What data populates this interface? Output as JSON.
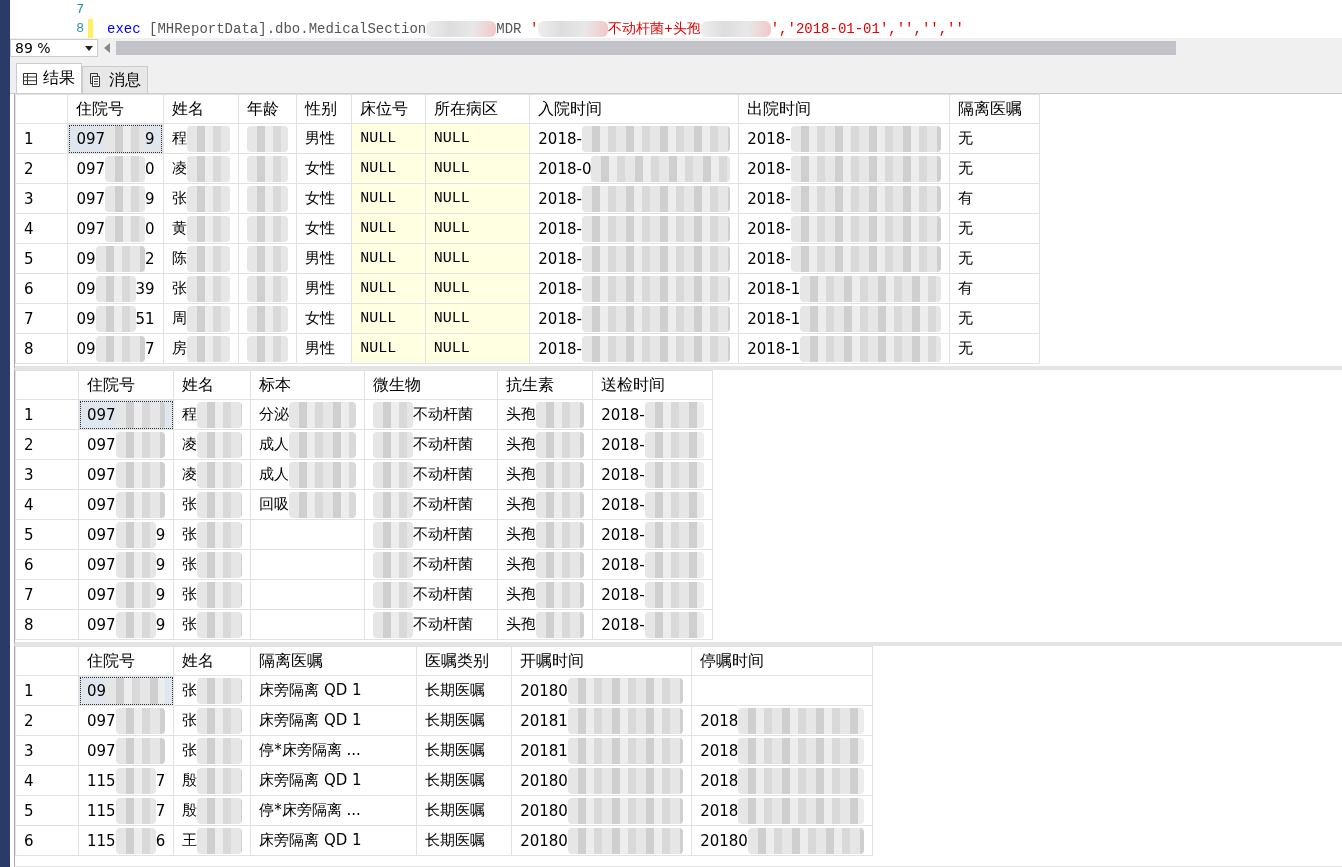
{
  "editor": {
    "lines": [
      {
        "number": "7",
        "changed": false
      },
      {
        "number": "8",
        "changed": true,
        "segments": [
          {
            "kind": "keyword",
            "text": "exec"
          },
          {
            "kind": "plain",
            "text": " [MHReportData].dbo.MedicalSection"
          },
          {
            "kind": "redacted"
          },
          {
            "kind": "plain",
            "text": "MDR "
          },
          {
            "kind": "string",
            "text": "'"
          },
          {
            "kind": "redacted"
          },
          {
            "kind": "string",
            "text": "不动杆菌+头孢"
          },
          {
            "kind": "redacted"
          },
          {
            "kind": "string",
            "text": "','2018-01-01','','',''"
          }
        ]
      }
    ]
  },
  "zoom": "89 %",
  "tabs": [
    {
      "label": "结果",
      "selected": true
    },
    {
      "label": "消息",
      "selected": false
    }
  ],
  "results": [
    {
      "columns": [
        "住院号",
        "姓名",
        "年龄",
        "性别",
        "床位号",
        "所在病区",
        "入院时间",
        "出院时间",
        "隔离医嘱"
      ],
      "rows": [
        {
          "num": "1",
          "focused": true,
          "cells": [
            {
              "text": "097",
              "tail": "9",
              "redacted": true
            },
            {
              "text": "程",
              "redacted": true
            },
            {
              "redacted": true
            },
            {
              "text": "男性"
            },
            {
              "text": "NULL",
              "kind": "null"
            },
            {
              "text": "NULL",
              "kind": "null"
            },
            {
              "text": "2018-",
              "redacted": true
            },
            {
              "text": "2018-",
              "redacted": true
            },
            {
              "text": "无"
            }
          ]
        },
        {
          "num": "2",
          "focused": false,
          "cells": [
            {
              "text": "097",
              "tail": "0",
              "redacted": true
            },
            {
              "text": "凌",
              "redacted": true
            },
            {
              "redacted": true
            },
            {
              "text": "女性"
            },
            {
              "text": "NULL",
              "kind": "null"
            },
            {
              "text": "NULL",
              "kind": "null"
            },
            {
              "text": "2018-0",
              "redacted": true
            },
            {
              "text": "2018-",
              "redacted": true
            },
            {
              "text": "无"
            }
          ]
        },
        {
          "num": "3",
          "focused": false,
          "cells": [
            {
              "text": "097",
              "tail": "9",
              "redacted": true
            },
            {
              "text": "张",
              "redacted": true
            },
            {
              "redacted": true
            },
            {
              "text": "女性"
            },
            {
              "text": "NULL",
              "kind": "null"
            },
            {
              "text": "NULL",
              "kind": "null"
            },
            {
              "text": "2018-",
              "redacted": true
            },
            {
              "text": "2018-",
              "redacted": true
            },
            {
              "text": "有"
            }
          ]
        },
        {
          "num": "4",
          "focused": false,
          "cells": [
            {
              "text": "097",
              "tail": "0",
              "redacted": true
            },
            {
              "text": "黄",
              "redacted": true
            },
            {
              "redacted": true
            },
            {
              "text": "女性"
            },
            {
              "text": "NULL",
              "kind": "null"
            },
            {
              "text": "NULL",
              "kind": "null"
            },
            {
              "text": "2018-",
              "redacted": true
            },
            {
              "text": "2018-",
              "redacted": true
            },
            {
              "text": "无"
            }
          ]
        },
        {
          "num": "5",
          "focused": false,
          "cells": [
            {
              "text": "09",
              "tail": "2",
              "redacted": true
            },
            {
              "text": "陈",
              "redacted": true
            },
            {
              "redacted": true
            },
            {
              "text": "男性"
            },
            {
              "text": "NULL",
              "kind": "null"
            },
            {
              "text": "NULL",
              "kind": "null"
            },
            {
              "text": "2018-",
              "redacted": true
            },
            {
              "text": "2018-",
              "redacted": true
            },
            {
              "text": "无"
            }
          ]
        },
        {
          "num": "6",
          "focused": false,
          "cells": [
            {
              "text": "09",
              "tail": "39",
              "redacted": true
            },
            {
              "text": "张",
              "redacted": true
            },
            {
              "redacted": true
            },
            {
              "text": "男性"
            },
            {
              "text": "NULL",
              "kind": "null"
            },
            {
              "text": "NULL",
              "kind": "null"
            },
            {
              "text": "2018-",
              "redacted": true
            },
            {
              "text": "2018-1",
              "redacted": true
            },
            {
              "text": "有"
            }
          ]
        },
        {
          "num": "7",
          "focused": false,
          "cells": [
            {
              "text": "09",
              "tail": "51",
              "redacted": true
            },
            {
              "text": "周",
              "redacted": true
            },
            {
              "redacted": true
            },
            {
              "text": "女性"
            },
            {
              "text": "NULL",
              "kind": "null"
            },
            {
              "text": "NULL",
              "kind": "null"
            },
            {
              "text": "2018-",
              "redacted": true
            },
            {
              "text": "2018-1",
              "redacted": true
            },
            {
              "text": "无"
            }
          ]
        },
        {
          "num": "8",
          "focused": false,
          "cells": [
            {
              "text": "09",
              "tail": "7",
              "redacted": true
            },
            {
              "text": "房",
              "redacted": true
            },
            {
              "redacted": true
            },
            {
              "text": "男性"
            },
            {
              "text": "NULL",
              "kind": "null"
            },
            {
              "text": "NULL",
              "kind": "null"
            },
            {
              "text": "2018-",
              "redacted": true
            },
            {
              "text": "2018-1",
              "redacted": true
            },
            {
              "text": "无"
            }
          ]
        }
      ]
    },
    {
      "columns": [
        "住院号",
        "姓名",
        "标本",
        "微生物",
        "抗生素",
        "送检时间"
      ],
      "rows": [
        {
          "num": "1",
          "focused": true,
          "cells": [
            {
              "text": "097",
              "redacted": true
            },
            {
              "text": "程",
              "redacted": true
            },
            {
              "text": "分泌",
              "redacted": true
            },
            {
              "text": "不动杆菌",
              "redacted": true,
              "lead": true
            },
            {
              "text": "头孢",
              "redacted": true
            },
            {
              "text": "2018-",
              "redacted": true
            }
          ]
        },
        {
          "num": "2",
          "focused": false,
          "cells": [
            {
              "text": "097",
              "redacted": true
            },
            {
              "text": "凌",
              "redacted": true
            },
            {
              "text": "成人",
              "redacted": true
            },
            {
              "text": "不动杆菌",
              "redacted": true,
              "lead": true
            },
            {
              "text": "头孢",
              "redacted": true
            },
            {
              "text": "2018-",
              "redacted": true
            }
          ]
        },
        {
          "num": "3",
          "focused": false,
          "cells": [
            {
              "text": "097",
              "redacted": true
            },
            {
              "text": "凌",
              "redacted": true
            },
            {
              "text": "成人",
              "redacted": true
            },
            {
              "text": "不动杆菌",
              "redacted": true,
              "lead": true
            },
            {
              "text": "头孢",
              "redacted": true
            },
            {
              "text": "2018-",
              "redacted": true
            }
          ]
        },
        {
          "num": "4",
          "focused": false,
          "cells": [
            {
              "text": "097",
              "redacted": true
            },
            {
              "text": "张",
              "redacted": true
            },
            {
              "text": "回吸",
              "redacted": true
            },
            {
              "text": "不动杆菌",
              "redacted": true,
              "lead": true
            },
            {
              "text": "头孢",
              "redacted": true
            },
            {
              "text": "2018-",
              "redacted": true
            }
          ]
        },
        {
          "num": "5",
          "focused": false,
          "cells": [
            {
              "text": "097",
              "tail": "9",
              "redacted": true
            },
            {
              "text": "张",
              "redacted": true
            },
            {},
            {
              "text": "不动杆菌",
              "redacted": true,
              "lead": true
            },
            {
              "text": "头孢",
              "redacted": true
            },
            {
              "text": "2018-",
              "redacted": true
            }
          ]
        },
        {
          "num": "6",
          "focused": false,
          "cells": [
            {
              "text": "097",
              "tail": "9",
              "redacted": true
            },
            {
              "text": "张",
              "redacted": true
            },
            {},
            {
              "text": "不动杆菌",
              "redacted": true,
              "lead": true
            },
            {
              "text": "头孢",
              "redacted": true
            },
            {
              "text": "2018-",
              "redacted": true
            }
          ]
        },
        {
          "num": "7",
          "focused": false,
          "cells": [
            {
              "text": "097",
              "tail": "9",
              "redacted": true
            },
            {
              "text": "张",
              "redacted": true
            },
            {},
            {
              "text": "不动杆菌",
              "redacted": true,
              "lead": true
            },
            {
              "text": "头孢",
              "redacted": true
            },
            {
              "text": "2018-",
              "redacted": true
            }
          ]
        },
        {
          "num": "8",
          "focused": false,
          "cells": [
            {
              "text": "097",
              "tail": "9",
              "redacted": true
            },
            {
              "text": "张",
              "redacted": true
            },
            {},
            {
              "text": "不动杆菌",
              "redacted": true,
              "lead": true
            },
            {
              "text": "头孢",
              "redacted": true
            },
            {
              "text": "2018-",
              "redacted": true
            }
          ]
        }
      ]
    },
    {
      "columns": [
        "住院号",
        "姓名",
        "隔离医嘱",
        "医嘱类别",
        "开嘱时间",
        "停嘱时间"
      ],
      "rows": [
        {
          "num": "1",
          "focused": true,
          "cells": [
            {
              "text": "09",
              "redacted": true
            },
            {
              "text": "张",
              "redacted": true
            },
            {
              "text": "床旁隔离    QD 1"
            },
            {
              "text": "长期医嘱"
            },
            {
              "text": "20180",
              "redacted": true
            },
            {}
          ]
        },
        {
          "num": "2",
          "focused": false,
          "cells": [
            {
              "text": "097",
              "redacted": true
            },
            {
              "text": "张",
              "redacted": true
            },
            {
              "text": "床旁隔离    QD 1"
            },
            {
              "text": "长期医嘱"
            },
            {
              "text": "20181",
              "redacted": true
            },
            {
              "text": "2018",
              "redacted": true
            }
          ]
        },
        {
          "num": "3",
          "focused": false,
          "cells": [
            {
              "text": "097",
              "redacted": true
            },
            {
              "text": "张",
              "redacted": true
            },
            {
              "text": "停*床旁隔离 ..."
            },
            {
              "text": "长期医嘱"
            },
            {
              "text": "20181",
              "redacted": true
            },
            {
              "text": "2018",
              "redacted": true
            }
          ]
        },
        {
          "num": "4",
          "focused": false,
          "cells": [
            {
              "text": "115",
              "tail": "7",
              "redacted": true
            },
            {
              "text": "殷",
              "redacted": true
            },
            {
              "text": "床旁隔离    QD 1"
            },
            {
              "text": "长期医嘱"
            },
            {
              "text": "20180",
              "redacted": true
            },
            {
              "text": "2018",
              "redacted": true
            }
          ]
        },
        {
          "num": "5",
          "focused": false,
          "cells": [
            {
              "text": "115",
              "tail": "7",
              "redacted": true
            },
            {
              "text": "殷",
              "redacted": true
            },
            {
              "text": "停*床旁隔离 ..."
            },
            {
              "text": "长期医嘱"
            },
            {
              "text": "20180",
              "redacted": true
            },
            {
              "text": "2018",
              "redacted": true
            }
          ]
        },
        {
          "num": "6",
          "focused": false,
          "cells": [
            {
              "text": "115",
              "tail": "6",
              "redacted": true
            },
            {
              "text": "王",
              "redacted": true
            },
            {
              "text": "床旁隔离    QD 1"
            },
            {
              "text": "长期医嘱"
            },
            {
              "text": "20180",
              "redacted": true
            },
            {
              "text": "20180",
              "redacted": true
            }
          ]
        }
      ]
    }
  ]
}
